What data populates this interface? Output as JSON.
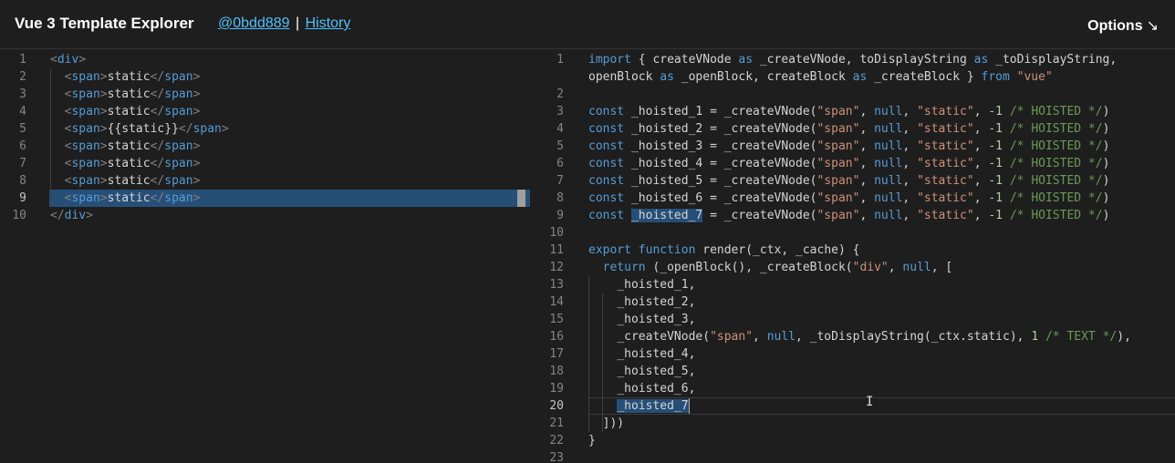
{
  "header": {
    "title": "Vue 3 Template Explorer",
    "commit": "@0bdd889",
    "separator": "|",
    "history": "History",
    "options": "Options",
    "options_arrow": "↘"
  },
  "template_lines": [
    {
      "n": "1",
      "code": "<div>"
    },
    {
      "n": "2",
      "code": "  <span>static</span>"
    },
    {
      "n": "3",
      "code": "  <span>static</span>"
    },
    {
      "n": "4",
      "code": "  <span>static</span>"
    },
    {
      "n": "5",
      "code": "  <span>{{static}}</span>"
    },
    {
      "n": "6",
      "code": "  <span>static</span>"
    },
    {
      "n": "7",
      "code": "  <span>static</span>"
    },
    {
      "n": "8",
      "code": "  <span>static</span>"
    },
    {
      "n": "9",
      "code": "  <span>static</span>"
    },
    {
      "n": "10",
      "code": "</div>"
    }
  ],
  "output_lines": [
    {
      "n": "1",
      "code": "import { createVNode as _createVNode, toDisplayString as _toDisplayString,"
    },
    {
      "n": "",
      "code": "openBlock as _openBlock, createBlock as _createBlock } from \"vue\""
    },
    {
      "n": "2",
      "code": ""
    },
    {
      "n": "3",
      "code": "const _hoisted_1 = _createVNode(\"span\", null, \"static\", -1 /* HOISTED */)"
    },
    {
      "n": "4",
      "code": "const _hoisted_2 = _createVNode(\"span\", null, \"static\", -1 /* HOISTED */)"
    },
    {
      "n": "5",
      "code": "const _hoisted_3 = _createVNode(\"span\", null, \"static\", -1 /* HOISTED */)"
    },
    {
      "n": "6",
      "code": "const _hoisted_4 = _createVNode(\"span\", null, \"static\", -1 /* HOISTED */)"
    },
    {
      "n": "7",
      "code": "const _hoisted_5 = _createVNode(\"span\", null, \"static\", -1 /* HOISTED */)"
    },
    {
      "n": "8",
      "code": "const _hoisted_6 = _createVNode(\"span\", null, \"static\", -1 /* HOISTED */)"
    },
    {
      "n": "9",
      "code": "const _hoisted_7 = _createVNode(\"span\", null, \"static\", -1 /* HOISTED */)"
    },
    {
      "n": "10",
      "code": ""
    },
    {
      "n": "11",
      "code": "export function render(_ctx, _cache) {"
    },
    {
      "n": "12",
      "code": "  return (_openBlock(), _createBlock(\"div\", null, ["
    },
    {
      "n": "13",
      "code": "    _hoisted_1,"
    },
    {
      "n": "14",
      "code": "    _hoisted_2,"
    },
    {
      "n": "15",
      "code": "    _hoisted_3,"
    },
    {
      "n": "16",
      "code": "    _createVNode(\"span\", null, _toDisplayString(_ctx.static), 1 /* TEXT */),"
    },
    {
      "n": "17",
      "code": "    _hoisted_4,"
    },
    {
      "n": "18",
      "code": "    _hoisted_5,"
    },
    {
      "n": "19",
      "code": "    _hoisted_6,"
    },
    {
      "n": "20",
      "code": "    _hoisted_7"
    },
    {
      "n": "21",
      "code": "  ]))"
    },
    {
      "n": "22",
      "code": "}"
    },
    {
      "n": "23",
      "code": ""
    }
  ],
  "colors": {
    "background": "#1e1e1e",
    "selection": "#264f78",
    "keyword": "#569cd6",
    "string": "#ce9178",
    "number": "#b5cea8",
    "comment": "#6a9955",
    "link": "#4fc1ff",
    "line_number": "#858585"
  },
  "icons": {
    "cursor": "text-cursor-icon"
  }
}
